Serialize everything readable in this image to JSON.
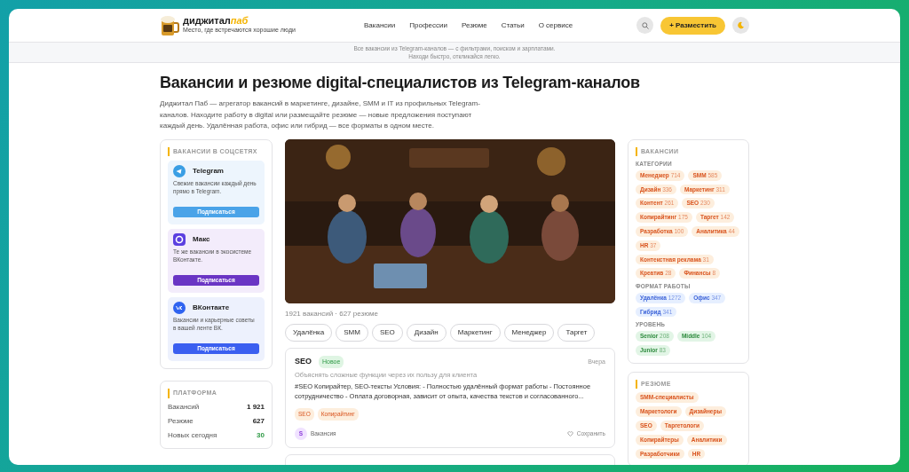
{
  "header": {
    "brand": "диджитал",
    "brand_accent": "паб",
    "tagline": "Место, где встречаются хорошие люди",
    "nav": [
      "Вакансии",
      "Профессии",
      "Резюме",
      "Статьи",
      "О сервисе"
    ],
    "post_button": "+ Разместить"
  },
  "announcement": [
    "Все вакансии из Telegram-каналов — с фильтрами, поиском и зарплатами.",
    "Находи быстро, откликайся легко."
  ],
  "title": "Вакансии и резюме digital-специалистов из Telegram-каналов",
  "intro": "Диджитал Паб — агрегатор вакансий в маркетинге, дизайне, SMM и IT из профильных Telegram-каналов. Находите работу в digital или размещайте резюме — новые предложения поступают каждый день. Удалённая работа, офис или гибрид — все форматы в одном месте.",
  "social": {
    "heading": "ВАКАНСИИ В СОЦСЕТЯХ",
    "channels": [
      {
        "kind": "telegram",
        "name": "Telegram",
        "text": "Свежие вакансии каждый день прямо в Telegram.",
        "button": "Подписаться"
      },
      {
        "kind": "max",
        "name": "Макс",
        "text": "Те же вакансии в экосистеме ВКонтакте.",
        "button": "Подписаться"
      },
      {
        "kind": "vk",
        "name": "ВКонтакте",
        "text": "Вакансии и карьерные советы в вашей ленте ВК.",
        "button": "Подписаться"
      }
    ]
  },
  "platform": {
    "heading": "ПЛАТФОРМА",
    "stats": [
      {
        "label": "Вакансий",
        "value": "1 921",
        "highlight": false
      },
      {
        "label": "Резюме",
        "value": "627",
        "highlight": false
      },
      {
        "label": "Новых сегодня",
        "value": "30",
        "highlight": true
      }
    ]
  },
  "feed": {
    "summary": "1921 вакансий · 627 резюме",
    "filters": [
      "Удалёнка",
      "SMM",
      "SEO",
      "Дизайн",
      "Маркетинг",
      "Менеджер",
      "Таргет"
    ],
    "posts": [
      {
        "title": "SEO",
        "badge": "Новое",
        "date": "Вчера",
        "subtitle": "Объяснять сложные функции через их пользу для клиента",
        "body": "#SEO Копирайтер, SEO-тексты Условия: - Полностью удалённый формат работы - Постоянное сотрудничество - Оплата договорная, зависит от опыта, качества текстов и согласованного...",
        "tags": [
          "SEO",
          "Копирайтинг"
        ],
        "avatar": "S",
        "type": "Вакансия",
        "save": "Сохранить"
      }
    ]
  },
  "vacancies": {
    "heading": "ВАКАНСИИ",
    "groups": [
      {
        "title": "КАТЕГОРИИ",
        "kind": "category",
        "tags": [
          {
            "label": "Менеджер",
            "count": "714"
          },
          {
            "label": "SMM",
            "count": "585"
          },
          {
            "label": "Дизайн",
            "count": "336"
          },
          {
            "label": "Маркетинг",
            "count": "311"
          },
          {
            "label": "Контент",
            "count": "261"
          },
          {
            "label": "SEO",
            "count": "230"
          },
          {
            "label": "Копирайтинг",
            "count": "175"
          },
          {
            "label": "Таргет",
            "count": "142"
          },
          {
            "label": "Разработка",
            "count": "100"
          },
          {
            "label": "Аналитика",
            "count": "44"
          },
          {
            "label": "HR",
            "count": "37"
          },
          {
            "label": "Контекстная реклама",
            "count": "31"
          },
          {
            "label": "Креатив",
            "count": "28"
          },
          {
            "label": "Финансы",
            "count": "8"
          }
        ]
      },
      {
        "title": "ФОРМАТ РАБОТЫ",
        "kind": "format",
        "tags": [
          {
            "label": "Удалёнка",
            "count": "1272"
          },
          {
            "label": "Офис",
            "count": "347"
          },
          {
            "label": "Гибрид",
            "count": "341"
          }
        ]
      },
      {
        "title": "УРОВЕНЬ",
        "kind": "level",
        "tags": [
          {
            "label": "Senior",
            "count": "208"
          },
          {
            "label": "Middle",
            "count": "104"
          },
          {
            "label": "Junior",
            "count": "83"
          }
        ]
      }
    ]
  },
  "resumes": {
    "heading": "РЕЗЮМЕ",
    "tags": [
      "SMM-специалисты",
      "Маркетологи",
      "Дизайнеры",
      "SEO",
      "Таргетологи",
      "Копирайтеры",
      "Аналитики",
      "Разработчики",
      "HR"
    ]
  }
}
